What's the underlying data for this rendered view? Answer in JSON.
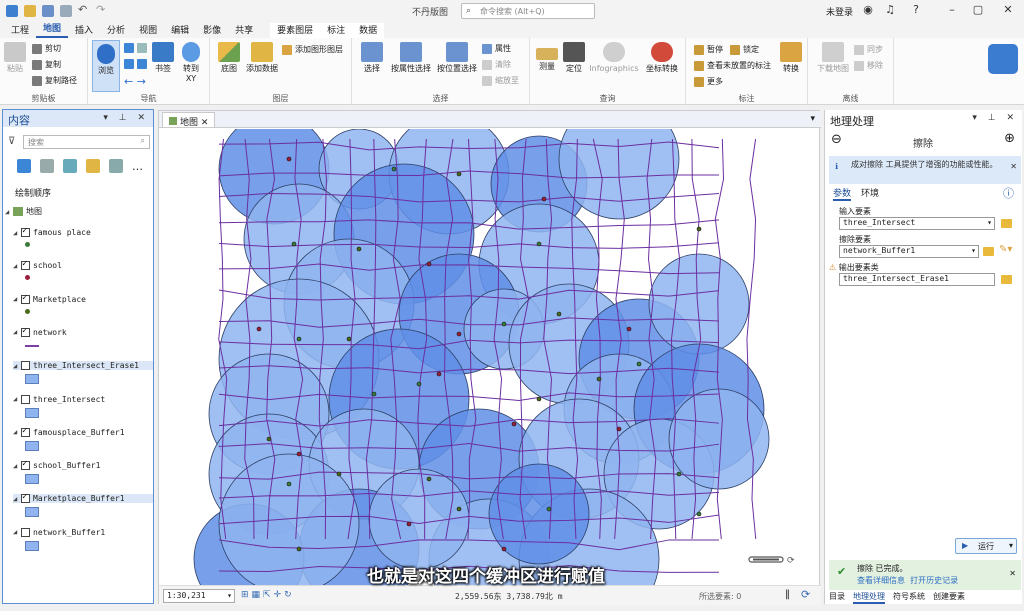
{
  "titlebar": {
    "doc_title": "不丹版图",
    "search_placeholder": "命令搜索 (Alt+Q)",
    "signin": "未登录",
    "colors": {
      "accent": "#2a5db0"
    }
  },
  "ribbon": {
    "tabs": [
      "工程",
      "地图",
      "插入",
      "分析",
      "视图",
      "编辑",
      "影像",
      "共享",
      "要素图层",
      "标注",
      "数据"
    ],
    "active_tab": "地图",
    "groups": {
      "clipboard": "剪贴板",
      "navigate": "导航",
      "layer": "图层",
      "selection": "选择",
      "inquiry": "查询",
      "labeling": "标注",
      "offline": "离线"
    },
    "buttons": {
      "paste": "粘贴",
      "cut": "剪切",
      "copy": "复制",
      "copy_path": "复制路径",
      "explore": "浏览",
      "bookmarks": "书签",
      "goto_xy": "转到 XY",
      "basemap": "底图",
      "add_data": "添加数据",
      "add_graphics": "添加图形图层",
      "select": "选择",
      "select_by_attr": "按属性选择",
      "select_by_loc": "按位置选择",
      "attributes": "属性",
      "clear": "清除",
      "zoom_to": "缩放至",
      "measure": "测量",
      "locate": "定位",
      "infographics": "Infographics",
      "coord_conversion": "坐标转换",
      "pause": "暂停",
      "lock": "锁定",
      "view_unplaced": "查看未放置的标注",
      "more": "更多",
      "convert": "转换",
      "download_map": "下载地图",
      "sync": "同步",
      "remove": "移除"
    }
  },
  "contents": {
    "title": "内容",
    "search_placeholder": "搜索",
    "draw_order": "绘制顺序",
    "map_name": "地图",
    "layers": [
      {
        "name": "famous place",
        "checked": true,
        "sym": "point",
        "color": "#3a7d3a"
      },
      {
        "name": "school",
        "checked": true,
        "sym": "point",
        "color": "#9b1f3a"
      },
      {
        "name": "Marketplace",
        "checked": true,
        "sym": "point",
        "color": "#4a6a1d"
      },
      {
        "name": "network",
        "checked": true,
        "sym": "line",
        "color": "#7b3fa6"
      },
      {
        "name": "three_Intersect_Erase1",
        "checked": false,
        "sym": "poly",
        "color": "#8fb4f0"
      },
      {
        "name": "three_Intersect",
        "checked": false,
        "sym": "poly",
        "color": "#8fb4f0"
      },
      {
        "name": "famousplace_Buffer1",
        "checked": true,
        "sym": "poly",
        "color": "#8fb4f0"
      },
      {
        "name": "school_Buffer1",
        "checked": true,
        "sym": "poly",
        "color": "#8fb4f0"
      },
      {
        "name": "Marketplace_Buffer1",
        "checked": true,
        "sym": "poly",
        "color": "#8fb4f0"
      },
      {
        "name": "network_Buffer1",
        "checked": false,
        "sym": "poly",
        "color": "#8fb4f0"
      }
    ]
  },
  "map": {
    "tab": "地图",
    "scale": "1:30,231",
    "coords": "2,559.56东 3,738.79北 m",
    "selected": "所选要素: 0"
  },
  "subtitle": "也就是对这四个缓冲区进行赋值",
  "geoprocessing": {
    "title": "地理处理",
    "tool": "擦除",
    "info": "成对擦除 工具提供了增强的功能或性能。",
    "tab_params": "参数",
    "tab_env": "环境",
    "input_label": "输入要素",
    "input_value": "three_Intersect",
    "erase_label": "擦除要素",
    "erase_value": "network_Buffer1",
    "output_label": "输出要素类",
    "output_value": "three_Intersect_Erase1",
    "run": "运行",
    "done": "擦除 已完成。",
    "details": "查看详细信息",
    "history": "打开历史记录",
    "bottom_tabs": [
      "目录",
      "地理处理",
      "符号系统",
      "创建要素"
    ]
  }
}
